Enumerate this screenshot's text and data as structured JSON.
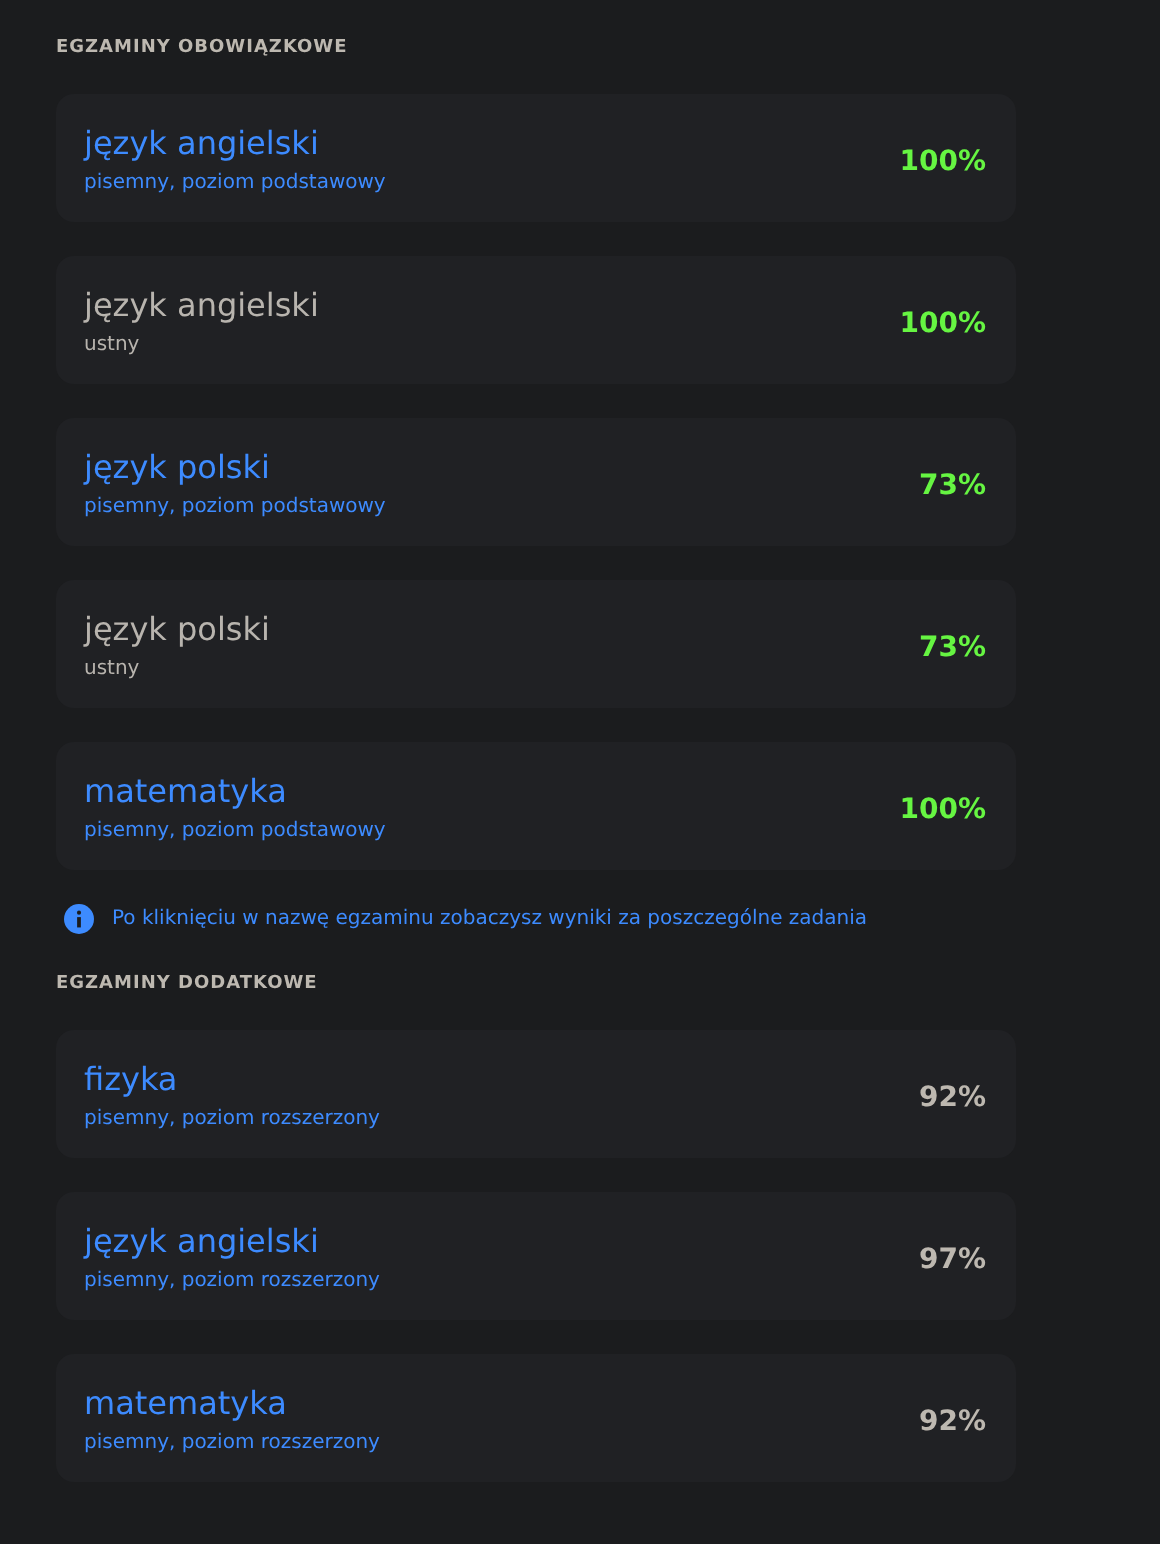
{
  "sections": [
    {
      "heading": "EGZAMINY OBOWIĄZKOWE",
      "kind": "mandatory",
      "exams": [
        {
          "title": "język angielski",
          "detail": "pisemny, poziom podstawowy",
          "score": "100%",
          "clickable": true
        },
        {
          "title": "język angielski",
          "detail": "ustny",
          "score": "100%",
          "clickable": false
        },
        {
          "title": "język polski",
          "detail": "pisemny, poziom podstawowy",
          "score": "73%",
          "clickable": true
        },
        {
          "title": "język polski",
          "detail": "ustny",
          "score": "73%",
          "clickable": false
        },
        {
          "title": "matematyka",
          "detail": "pisemny, poziom podstawowy",
          "score": "100%",
          "clickable": true
        }
      ],
      "note": "Po kliknięciu w nazwę egzaminu zobaczysz wyniki za poszczególne zadania"
    },
    {
      "heading": "EGZAMINY DODATKOWE",
      "kind": "additional",
      "exams": [
        {
          "title": "fizyka",
          "detail": "pisemny, poziom rozszerzony",
          "score": "92%",
          "clickable": true
        },
        {
          "title": "język angielski",
          "detail": "pisemny, poziom rozszerzony",
          "score": "97%",
          "clickable": true
        },
        {
          "title": "matematyka",
          "detail": "pisemny, poziom rozszerzony",
          "score": "92%",
          "clickable": true
        }
      ]
    }
  ]
}
